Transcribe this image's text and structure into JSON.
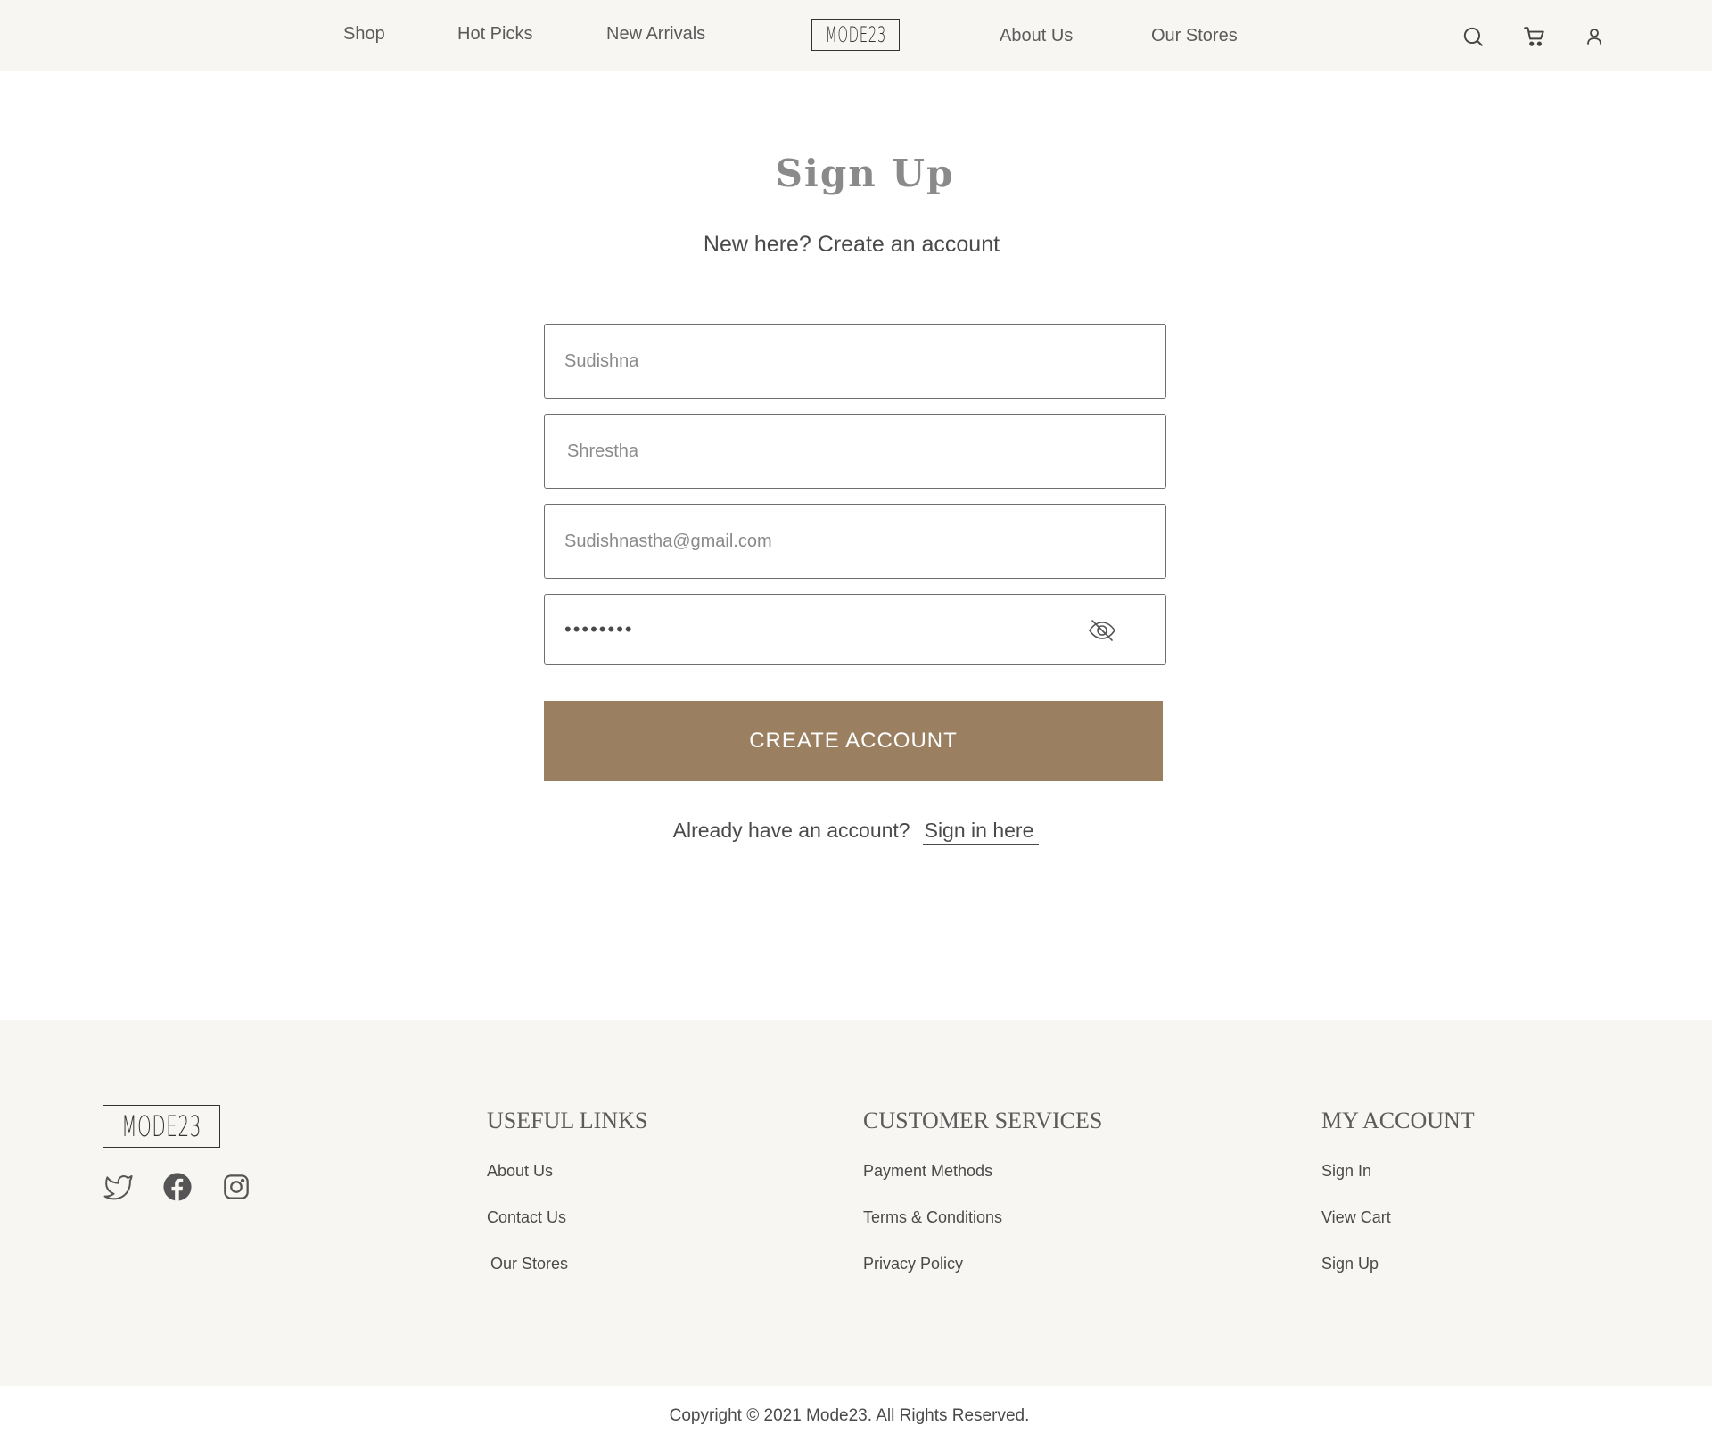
{
  "header": {
    "nav_left": [
      "Shop",
      "Hot Picks",
      "New Arrivals"
    ],
    "logo": "MODE23",
    "nav_right": [
      "About Us",
      "Our Stores"
    ],
    "icons": [
      "search-icon",
      "cart-icon",
      "user-icon"
    ]
  },
  "main": {
    "title": "Sign Up",
    "subtitle": "New here? Create an account",
    "fields": {
      "first_name": "Sudishna",
      "last_name": "Shrestha",
      "email": "Sudishnastha@gmail.com",
      "password": "••••••••"
    },
    "submit_label": "CREATE ACCOUNT",
    "signin_prompt": "Already have an account?",
    "signin_link": "Sign in here"
  },
  "footer": {
    "logo": "MODE23",
    "social": [
      "twitter-icon",
      "facebook-icon",
      "instagram-icon"
    ],
    "useful_links": {
      "heading": "USEFUL LINKS",
      "links": [
        "About Us",
        "Contact Us",
        "Our Stores"
      ]
    },
    "customer_services": {
      "heading": "CUSTOMER SERVICES",
      "links": [
        "Payment Methods",
        "Terms & Conditions",
        "Privacy Policy"
      ]
    },
    "my_account": {
      "heading": "MY ACCOUNT",
      "links": [
        "Sign In",
        "View Cart",
        "Sign Up"
      ]
    },
    "copyright": "Copyright © 2021 Mode23. All Rights Reserved."
  },
  "colors": {
    "accent": "#9a7f61",
    "header_bg": "#f8f6f2",
    "footer_bg": "#f8f6f2",
    "text": "#4a4a4a"
  }
}
